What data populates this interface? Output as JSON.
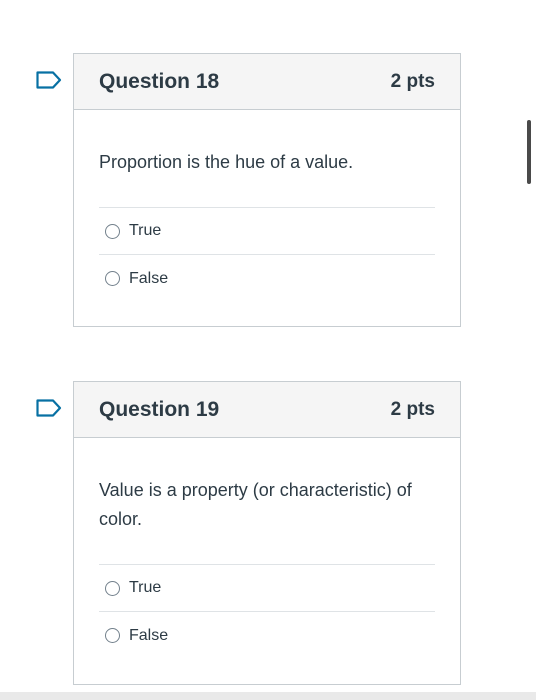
{
  "questions": [
    {
      "title": "Question 18",
      "points": "2 pts",
      "prompt": "Proportion is the hue of a value.",
      "answers": [
        "True",
        "False"
      ]
    },
    {
      "title": "Question 19",
      "points": "2 pts",
      "prompt": "Value is a property (or characteristic) of color.",
      "answers": [
        "True",
        "False"
      ]
    }
  ],
  "colors": {
    "flag": "#0770a3",
    "header_bg": "#f5f5f5",
    "border": "#c7cdd1",
    "text": "#2d3b45"
  },
  "icons": {
    "flag": "flag-icon",
    "radio": "radio-button"
  }
}
